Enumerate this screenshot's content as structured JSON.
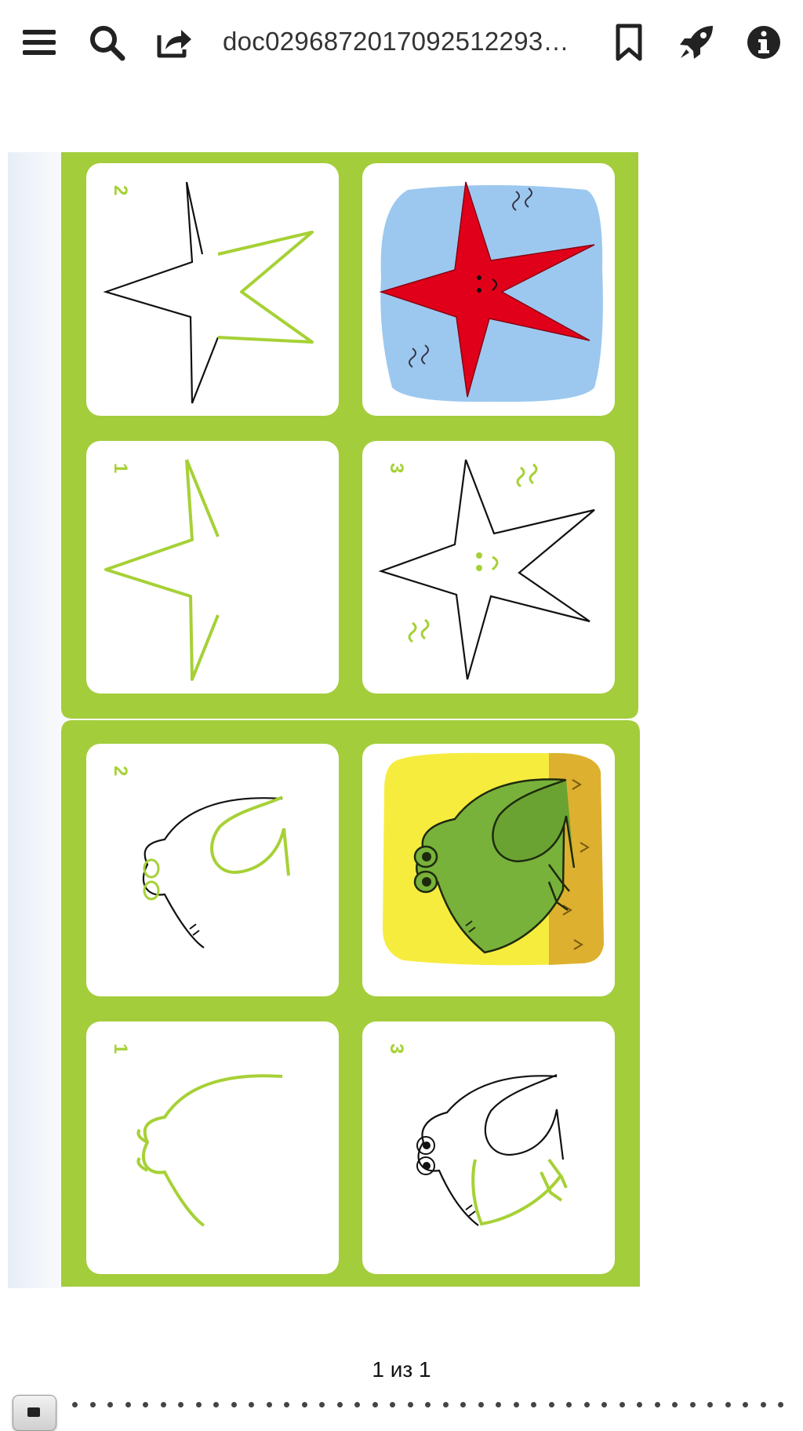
{
  "toolbar": {
    "menu_icon": "hamburger-menu-icon",
    "search_icon": "search-icon",
    "share_icon": "share-icon",
    "title": "doc02968720170925122939.pdf",
    "bookmark_icon": "bookmark-icon",
    "rocket_icon": "rocket-icon",
    "info_icon": "info-icon"
  },
  "document": {
    "top_card": {
      "subject": "starfish",
      "panels": [
        {
          "step": "2",
          "position": "top-left"
        },
        {
          "step": "",
          "position": "top-right",
          "type": "colored-result"
        },
        {
          "step": "1",
          "position": "bottom-left"
        },
        {
          "step": "3",
          "position": "bottom-right"
        }
      ]
    },
    "bottom_card": {
      "subject": "frog",
      "panels": [
        {
          "step": "2",
          "position": "top-left"
        },
        {
          "step": "",
          "position": "top-right",
          "type": "colored-result"
        },
        {
          "step": "1",
          "position": "bottom-left"
        },
        {
          "step": "3",
          "position": "bottom-right"
        }
      ]
    },
    "colors": {
      "card_green": "#a3cd3b",
      "line_green": "#a6d136",
      "star_red": "#e1001a",
      "sky_blue": "#9cc8ef",
      "frog_green": "#78b23a",
      "sand_yellow": "#f6ec3e",
      "ground_ochre": "#ddb12f"
    }
  },
  "footer": {
    "page_indicator": "1 из 1",
    "scrubber_thumb": "page-thumbnail"
  }
}
